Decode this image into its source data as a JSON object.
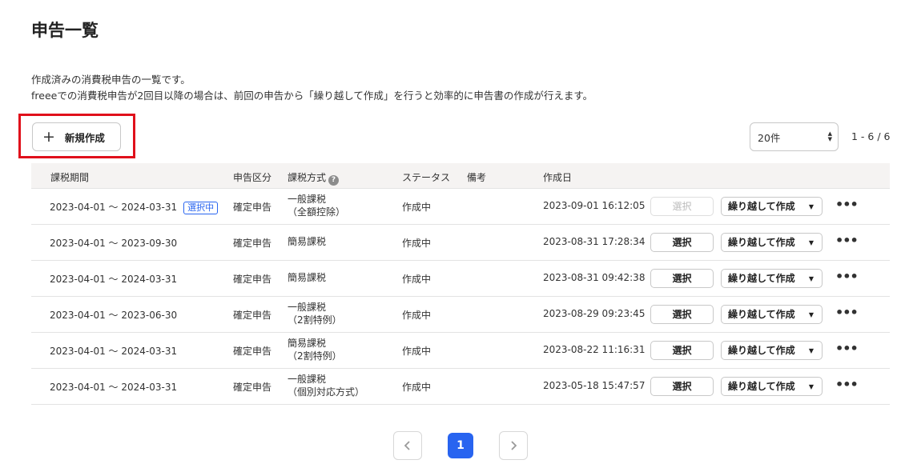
{
  "page": {
    "title": "申告一覧",
    "desc1": "作成済みの消費税申告の一覧です。",
    "desc2": "freeeでの消費税申告が2回目以降の場合は、前回の申告から「繰り越して作成」を行うと効率的に申告書の作成が行えます。"
  },
  "toolbar": {
    "new_label": "新規作成",
    "new_icon": "plus-icon",
    "per_page": "20件",
    "range": "1 - 6 / 6"
  },
  "table": {
    "headers": {
      "period": "課税期間",
      "kind": "申告区分",
      "method": "課税方式",
      "status": "ステータス",
      "note": "備考",
      "created": "作成日"
    },
    "rows": [
      {
        "period": "2023-04-01 〜 2024-03-31",
        "badge": "選択中",
        "kind": "確定申告",
        "method1": "一般課税",
        "method2": "（全額控除）",
        "status": "作成中",
        "created": "2023-09-01 16:12:05",
        "select": "選択",
        "carry": "繰り越して作成"
      },
      {
        "period": "2023-04-01 〜 2023-09-30",
        "kind": "確定申告",
        "method1": "簡易課税",
        "method2": "",
        "status": "作成中",
        "created": "2023-08-31 17:28:34",
        "select": "選択",
        "carry": "繰り越して作成"
      },
      {
        "period": "2023-04-01 〜 2024-03-31",
        "kind": "確定申告",
        "method1": "簡易課税",
        "method2": "",
        "status": "作成中",
        "created": "2023-08-31 09:42:38",
        "select": "選択",
        "carry": "繰り越して作成"
      },
      {
        "period": "2023-04-01 〜 2023-06-30",
        "kind": "確定申告",
        "method1": "一般課税",
        "method2": "（2割特例）",
        "status": "作成中",
        "created": "2023-08-29 09:23:45",
        "select": "選択",
        "carry": "繰り越して作成"
      },
      {
        "period": "2023-04-01 〜 2024-03-31",
        "kind": "確定申告",
        "method1": "簡易課税",
        "method2": "（2割特例）",
        "status": "作成中",
        "created": "2023-08-22 11:16:31",
        "select": "選択",
        "carry": "繰り越して作成"
      },
      {
        "period": "2023-04-01 〜 2024-03-31",
        "kind": "確定申告",
        "method1": "一般課税",
        "method2": "（個別対応方式）",
        "status": "作成中",
        "created": "2023-05-18 15:47:57",
        "select": "選択",
        "carry": "繰り越して作成"
      }
    ]
  },
  "pagination": {
    "current": "1"
  },
  "colors": {
    "accent": "#2864f0",
    "highlight": "#e0101b",
    "header_bg": "#f5f3f2"
  }
}
